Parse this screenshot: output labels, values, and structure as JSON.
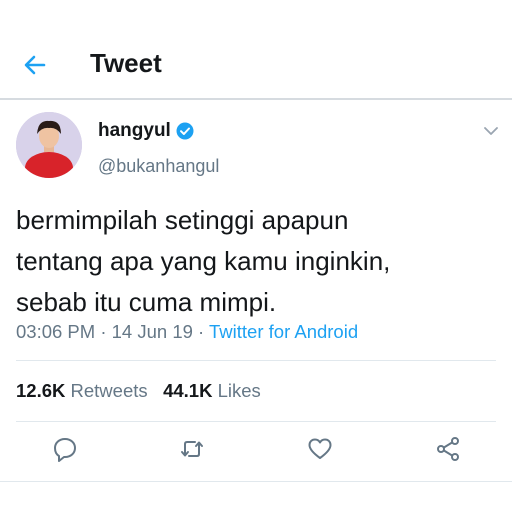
{
  "header": {
    "title": "Tweet",
    "back_icon": "arrow-left-icon"
  },
  "author": {
    "name": "hangyul",
    "handle": "@bukanhangul",
    "verified_icon": "verified-badge-icon"
  },
  "tweet": {
    "lines": [
      "bermimpilah setinggi apapun",
      "tentang apa yang kamu inginkin,",
      "sebab itu cuma mimpi."
    ],
    "time": "03:06 PM",
    "date": "14 Jun 19",
    "sep": "·",
    "source": "Twitter for Android"
  },
  "stats": {
    "retweets": "12.6K",
    "retweets_label": "Retweets",
    "likes": "44.1K",
    "likes_label": "Likes"
  },
  "colors": {
    "accent": "#1da1f2",
    "muted": "#657786"
  }
}
